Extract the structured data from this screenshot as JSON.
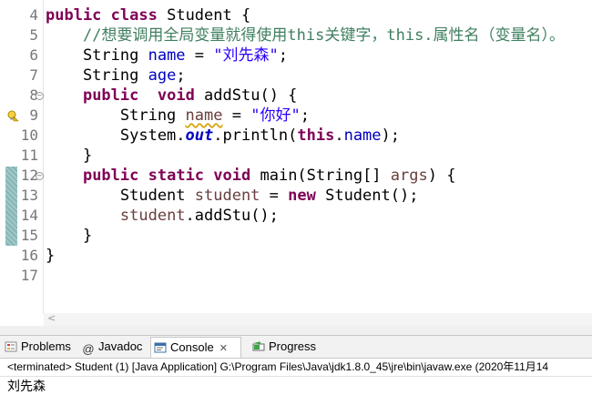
{
  "editor": {
    "lines": [
      {
        "n": "4",
        "html": "<span class=\"kw\">public</span> <span class=\"kw\">class</span> Student {"
      },
      {
        "n": "5",
        "html": "    <span class=\"cmt\">//想要调用全局变量就得使用this关键字，this.属性名（变量名）。</span>"
      },
      {
        "n": "6",
        "html": "    String <span class=\"fld\">name</span> = <span class=\"str\">\"刘先森\"</span>;"
      },
      {
        "n": "7",
        "html": "    String <span class=\"fld\">age</span>;"
      },
      {
        "n": "8",
        "html": "    <span class=\"kw\">public</span>  <span class=\"kw\">void</span> addStu() {",
        "fold": true
      },
      {
        "n": "9",
        "html": "        String <span class=\"var warnline\">name</span> = <span class=\"str\">\"你好\"</span>;",
        "warning": true
      },
      {
        "n": "10",
        "html": "        System.<span class=\"sfld\">out</span>.println(<span class=\"kw\">this</span>.<span class=\"fld\">name</span>);"
      },
      {
        "n": "11",
        "html": "    }"
      },
      {
        "n": "12",
        "html": "    <span class=\"kw\">public</span> <span class=\"kw\">static</span> <span class=\"kw\">void</span> main(String[] <span class=\"var\">args</span>) {",
        "fold": true
      },
      {
        "n": "13",
        "html": "        Student <span class=\"var\">student</span> = <span class=\"kw\">new</span> Student();"
      },
      {
        "n": "14",
        "html": "        <span class=\"var\">student</span>.addStu();"
      },
      {
        "n": "15",
        "html": "    }"
      },
      {
        "n": "16",
        "html": "}"
      },
      {
        "n": "17",
        "html": ""
      }
    ]
  },
  "tabs": {
    "problems": "Problems",
    "javadoc": "Javadoc",
    "console": "Console",
    "progress": "Progress"
  },
  "console": {
    "header": "<terminated> Student (1) [Java Application] G:\\Program Files\\Java\\jdk1.8.0_45\\jre\\bin\\javaw.exe (2020年11月14",
    "output": "刘先森"
  },
  "colors": {
    "keyword": "#7f0055",
    "field": "#0000c0",
    "string": "#2a00ff",
    "comment": "#3f7f5f",
    "local_var": "#6a3e3e",
    "change_bar": "#84b6b6"
  }
}
